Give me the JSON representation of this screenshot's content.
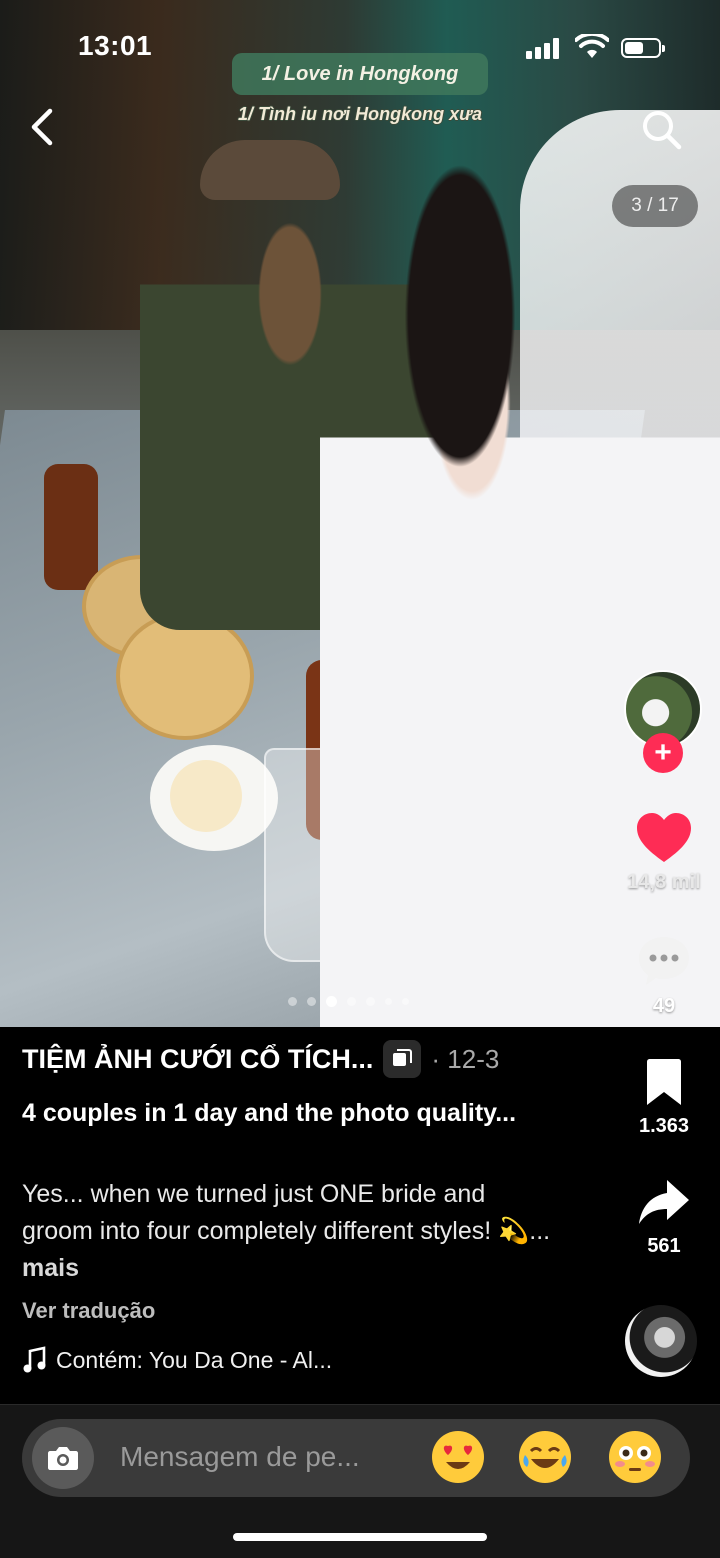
{
  "status": {
    "time": "13:01"
  },
  "overlay": {
    "title": "1/ Love in Hongkong",
    "subtitle": "1/ Tình iu nơi Hongkong xưa",
    "counter": "3 / 17"
  },
  "carousel": {
    "total_dots": 7,
    "active_index": 2
  },
  "rail": {
    "likes": "14,8 mil",
    "comments": "49",
    "saves": "1.363",
    "shares": "561"
  },
  "post": {
    "author": "TIỆM ẢNH CƯỚI CỔ TÍCH...",
    "date": "· 12-3",
    "headline": "4 couples in 1 day and the photo quality...",
    "description": "Yes... when we turned just ONE bride and groom into four completely different styles! 💫...",
    "more": "mais",
    "translate": "Ver tradução",
    "music": "Contém: You Da One - Al..."
  },
  "composer": {
    "placeholder": "Mensagem de pe...",
    "quick_emojis": [
      "heart-eyes",
      "tears-of-joy",
      "flushed"
    ]
  },
  "colors": {
    "like": "#fe2c55",
    "follow": "#fe2c55",
    "title_pill": "#40785c"
  }
}
